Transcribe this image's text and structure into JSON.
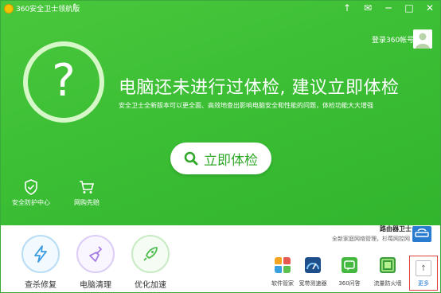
{
  "window": {
    "title": "360安全卫士领航版",
    "controls": [
      "↑",
      "✉",
      "─",
      "□",
      "✕"
    ]
  },
  "header": {
    "login_text": "登录360帐号"
  },
  "hero": {
    "symbol": "?",
    "heading": "电脑还未进行过体检, 建议立即体检",
    "subtext": "安全卫士全新版本可以更全面、高效地查出影响电脑安全和性能的问题，体检功能大大增强",
    "check_button": "立即体检"
  },
  "features": [
    {
      "label": "安全防护中心",
      "icon": "shield-check-icon"
    },
    {
      "label": "网购先赔",
      "icon": "cart-icon"
    }
  ],
  "tools": [
    {
      "label": "查杀修复",
      "icon": "lightning-icon",
      "color": "#3a9be0"
    },
    {
      "label": "电脑清理",
      "icon": "broom-icon",
      "color": "#a57de0"
    },
    {
      "label": "优化加速",
      "icon": "rocket-icon",
      "color": "#4ebc4e"
    }
  ],
  "router": {
    "title": "路由器卫士",
    "subtitle": "全新家庭网络管理，杉莓网控网"
  },
  "apps": [
    {
      "label": "软件管家",
      "icon": "software-manager-icon"
    },
    {
      "label": "宽带测速器",
      "icon": "speed-test-icon"
    },
    {
      "label": "360问答",
      "icon": "qa-icon"
    },
    {
      "label": "流量防火墙",
      "icon": "firewall-icon"
    }
  ],
  "more": {
    "label": "更多",
    "icon": "arrow-up-icon"
  }
}
